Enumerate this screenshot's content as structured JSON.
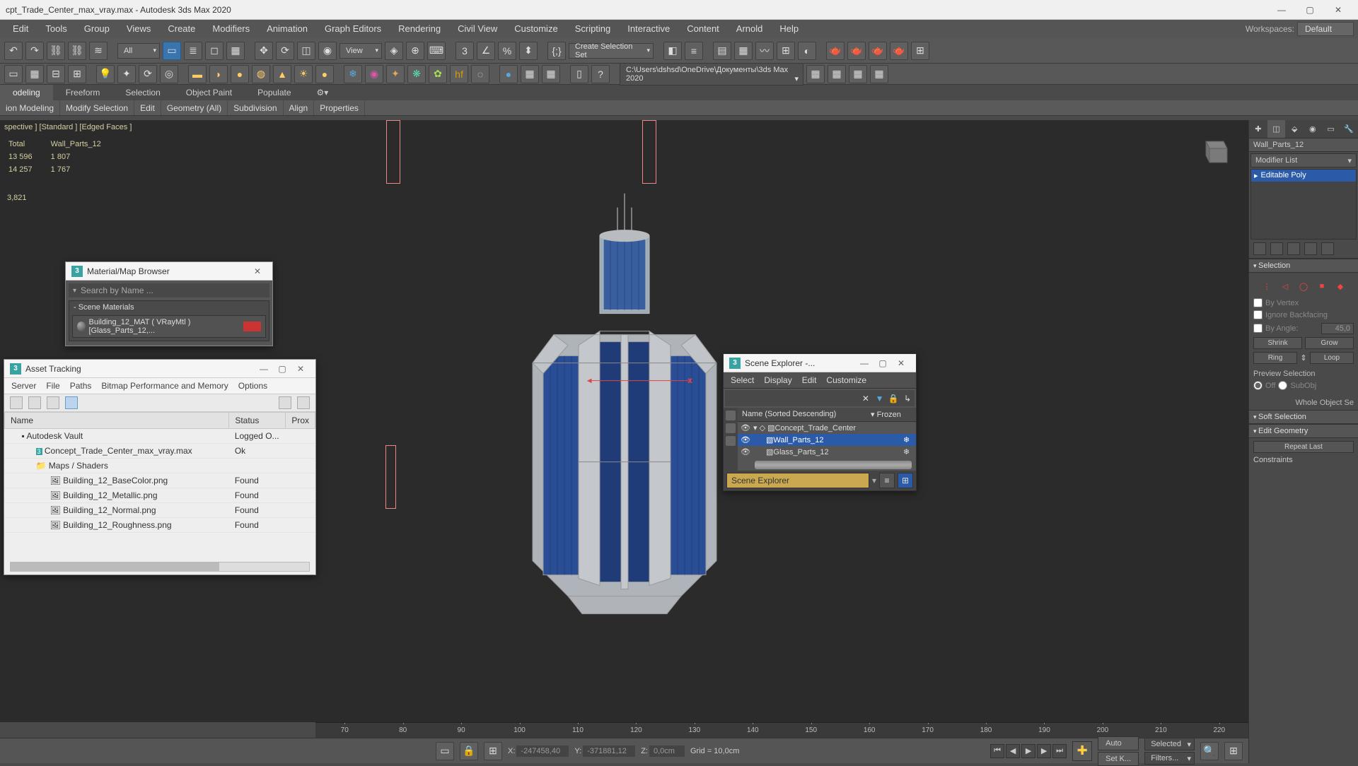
{
  "title": "cpt_Trade_Center_max_vray.max - Autodesk 3ds Max 2020",
  "menus": [
    "Edit",
    "Tools",
    "Group",
    "Views",
    "Create",
    "Modifiers",
    "Animation",
    "Graph Editors",
    "Rendering",
    "Civil View",
    "Customize",
    "Scripting",
    "Interactive",
    "Content",
    "Arnold",
    "Help"
  ],
  "workspace_label": "Workspaces:",
  "workspace_value": "Default",
  "toolbar1": {
    "all": "All",
    "view": "View",
    "selset": "Create Selection Set"
  },
  "project_path": "C:\\Users\\dshsd\\OneDrive\\Документы\\3ds Max 2020",
  "ribbon_tabs": [
    "odeling",
    "Freeform",
    "Selection",
    "Object Paint",
    "Populate"
  ],
  "ribbon_sub": [
    "ion Modeling",
    "Modify Selection",
    "Edit",
    "Geometry (All)",
    "Subdivision",
    "Align",
    "Properties"
  ],
  "viewport_label": "spective ] [Standard ] [Edged Faces ]",
  "stats": {
    "hdr_total": "Total",
    "hdr_obj": "Wall_Parts_12",
    "r1a": "13 596",
    "r1b": "1 807",
    "r2a": "14 257",
    "r2b": "1 767",
    "r3": "3,821"
  },
  "material_browser": {
    "title": "Material/Map Browser",
    "search_placeholder": "Search by Name ...",
    "section": "- Scene Materials",
    "item": "Building_12_MAT   ( VRayMtl )   [Glass_Parts_12,..."
  },
  "asset_tracking": {
    "title": "Asset Tracking",
    "menus": [
      "Server",
      "File",
      "Paths",
      "Bitmap Performance and Memory",
      "Options"
    ],
    "cols": [
      "Name",
      "Status",
      "Prox"
    ],
    "rows": [
      {
        "name": "Autodesk Vault",
        "status": "Logged O...",
        "indent": 1,
        "icon": "vault"
      },
      {
        "name": "Concept_Trade_Center_max_vray.max",
        "status": "Ok",
        "indent": 2,
        "icon": "max"
      },
      {
        "name": "Maps / Shaders",
        "status": "",
        "indent": 2,
        "icon": "folder"
      },
      {
        "name": "Building_12_BaseColor.png",
        "status": "Found",
        "indent": 3,
        "icon": "img"
      },
      {
        "name": "Building_12_Metallic.png",
        "status": "Found",
        "indent": 3,
        "icon": "img"
      },
      {
        "name": "Building_12_Normal.png",
        "status": "Found",
        "indent": 3,
        "icon": "img"
      },
      {
        "name": "Building_12_Roughness.png",
        "status": "Found",
        "indent": 3,
        "icon": "img"
      }
    ]
  },
  "scene_explorer": {
    "title": "Scene Explorer -...",
    "menus": [
      "Select",
      "Display",
      "Edit",
      "Customize"
    ],
    "col_name": "Name (Sorted Descending)",
    "col_frozen": "▾ Frozen",
    "rows": [
      {
        "name": "Concept_Trade_Center",
        "indent": 0,
        "sel": false
      },
      {
        "name": "Wall_Parts_12",
        "indent": 1,
        "sel": true
      },
      {
        "name": "Glass_Parts_12",
        "indent": 1,
        "sel": false
      }
    ],
    "footer": "Scene Explorer"
  },
  "cmdpanel": {
    "obj": "Wall_Parts_12",
    "modlist": "Modifier List",
    "moditem": "Editable Poly",
    "rollout_sel": "Selection",
    "by_vertex": "By Vertex",
    "ignore_bf": "Ignore Backfacing",
    "by_angle": "By Angle:",
    "angle_val": "45,0",
    "shrink": "Shrink",
    "grow": "Grow",
    "ring": "Ring",
    "loop": "Loop",
    "preview": "Preview Selection",
    "off": "Off",
    "subobj": "SubObj",
    "whole": "Whole Object Se",
    "soft_sel": "Soft Selection",
    "edit_geom": "Edit Geometry",
    "repeat": "Repeat Last",
    "constraints": "Constraints"
  },
  "timeline_ticks": [
    "70",
    "80",
    "90",
    "100",
    "110",
    "120",
    "130",
    "140",
    "150",
    "160",
    "170",
    "180",
    "190",
    "200",
    "210",
    "220"
  ],
  "status": {
    "x_label": "X:",
    "x_val": "-247458,40",
    "y_label": "Y:",
    "y_val": "-371881,12",
    "z_label": "Z:",
    "z_val": "0,0cm",
    "grid": "Grid = 10,0cm",
    "auto": "Auto",
    "setk": "Set K...",
    "selected": "Selected",
    "filters": "Filters..."
  }
}
